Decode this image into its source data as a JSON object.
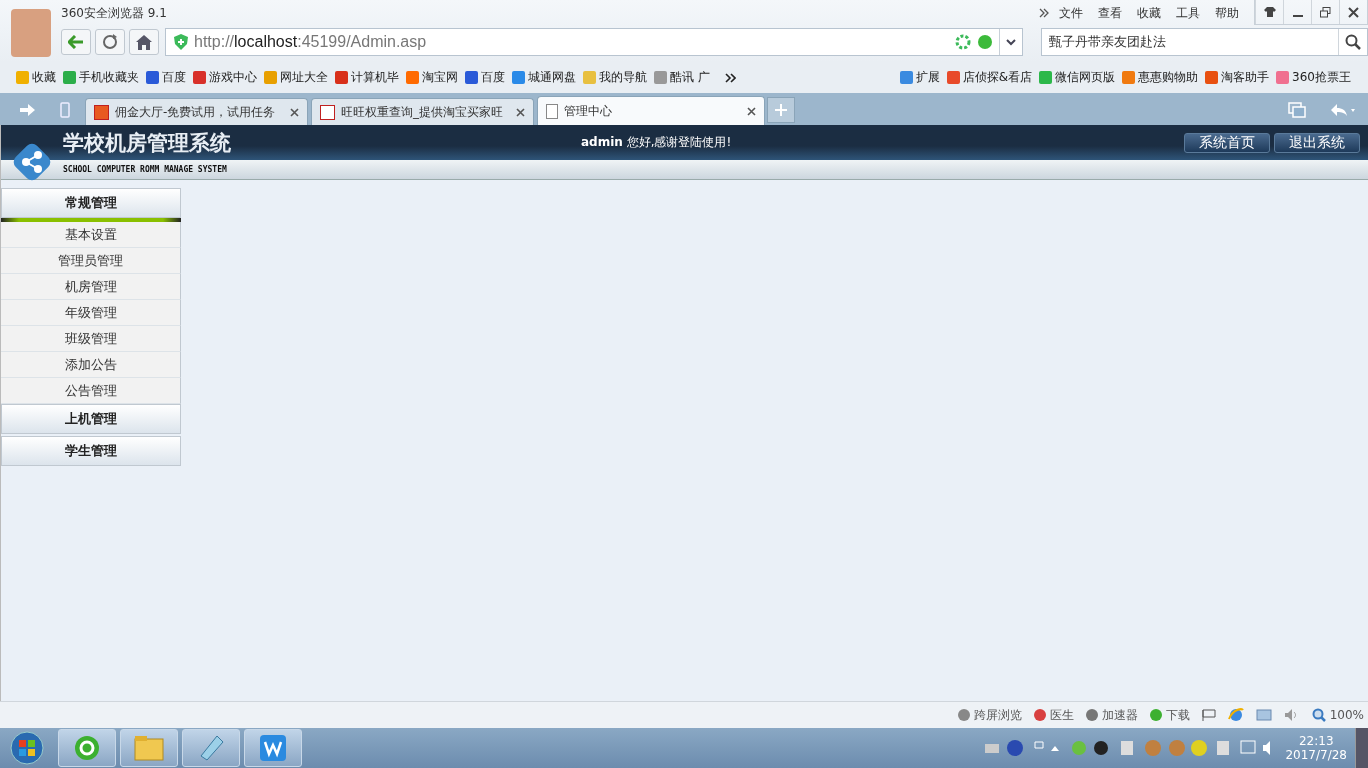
{
  "browser": {
    "title": "360安全浏览器 9.1",
    "menu": [
      "文件",
      "查看",
      "收藏",
      "工具",
      "帮助"
    ],
    "url": {
      "prefix": "http://",
      "host": "localhost",
      "suffix": ":45199/Admin.asp"
    },
    "search": {
      "value": "甄子丹带亲友团赴法"
    },
    "bookmarks": [
      "收藏",
      "手机收藏夹",
      "百度",
      "游戏中心",
      "网址大全",
      "计算机毕",
      "淘宝网",
      "百度",
      "城通网盘",
      "我的导航",
      "酷讯 广"
    ],
    "extensions": [
      "扩展",
      "店侦探&看店",
      "微信网页版",
      "惠惠购物助",
      "淘客助手",
      "360抢票王"
    ],
    "tabs": [
      {
        "label": "佣金大厅-免费试用，试用任务",
        "selected": false
      },
      {
        "label": "旺旺权重查询_提供淘宝买家旺",
        "selected": false
      },
      {
        "label": "管理中心",
        "selected": true
      }
    ]
  },
  "page": {
    "title": "学校机房管理系统",
    "subtitle": "SCHOOL COMPUTER ROMM MANAGE SYSTEM",
    "greeting": {
      "user": "admin",
      "text": "您好,感谢登陆使用!"
    },
    "buttons": [
      "系统首页",
      "退出系统"
    ],
    "sidebar": [
      {
        "label": "常规管理",
        "expanded": true,
        "items": [
          "基本设置",
          "管理员管理",
          "机房管理",
          "年级管理",
          "班级管理",
          "添加公告",
          "公告管理"
        ]
      },
      {
        "label": "上机管理",
        "expanded": false
      },
      {
        "label": "学生管理",
        "expanded": false
      }
    ]
  },
  "status_bar": {
    "items": [
      "跨屏浏览",
      "医生",
      "加速器",
      "下载"
    ],
    "zoom": "100%"
  },
  "taskbar": {
    "time": "22:13",
    "date": "2017/7/28"
  }
}
